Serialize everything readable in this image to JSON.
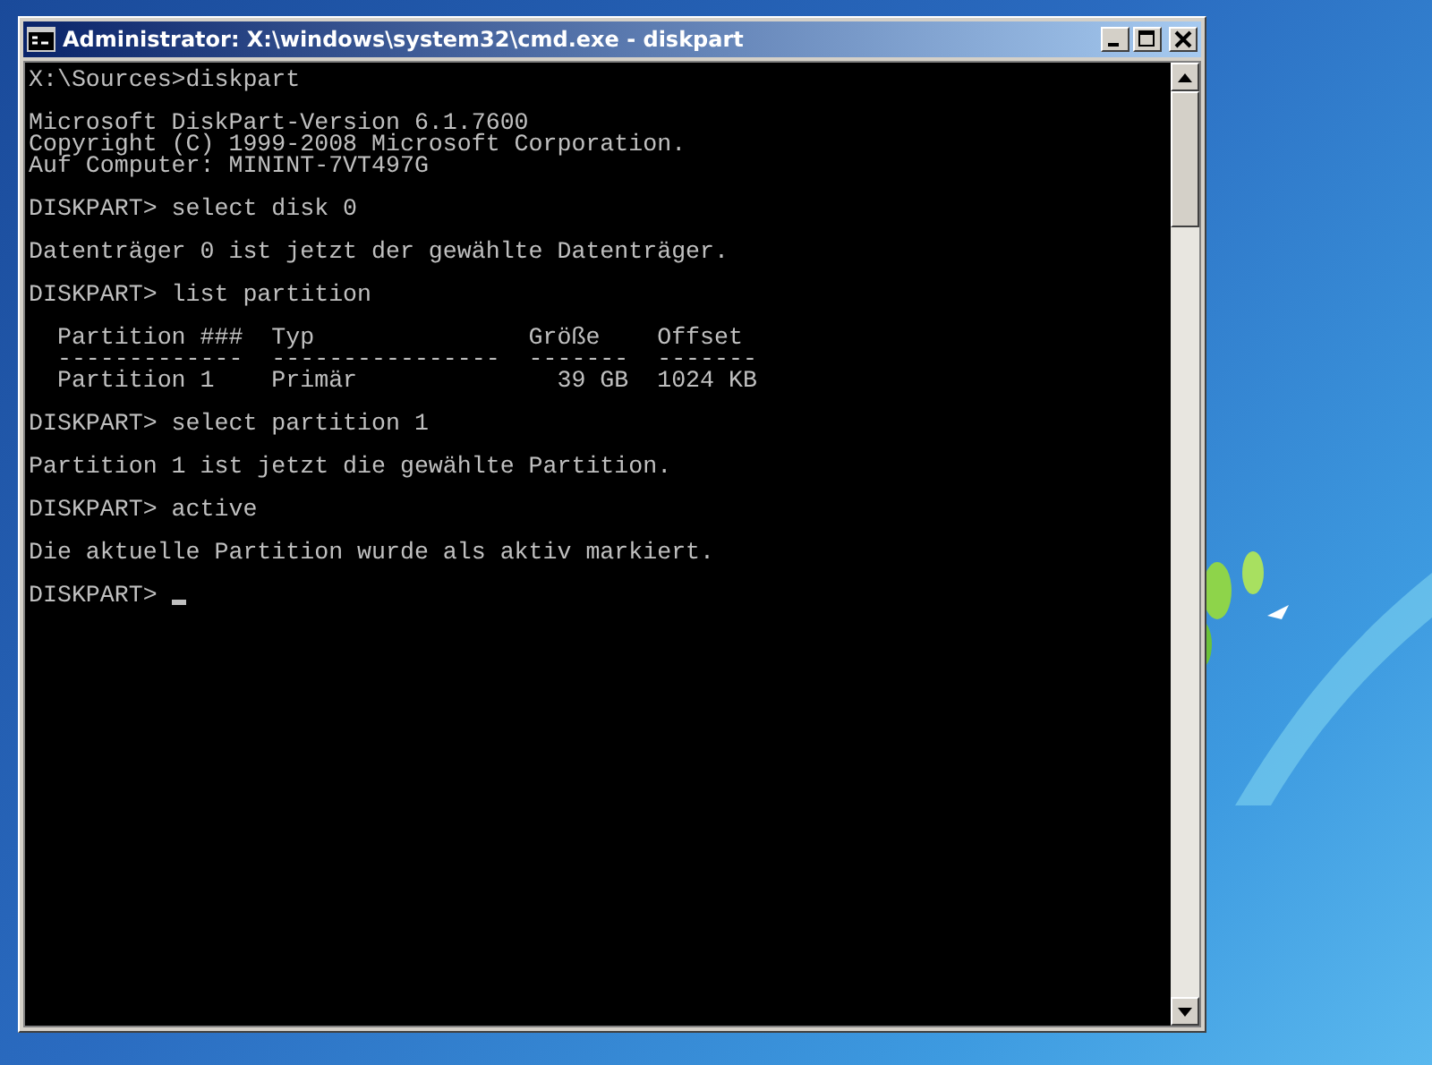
{
  "window": {
    "title": "Administrator: X:\\windows\\system32\\cmd.exe - diskpart"
  },
  "console": {
    "blocks": [
      [
        "X:\\Sources>diskpart"
      ],
      [
        "Microsoft DiskPart-Version 6.1.7600",
        "Copyright (C) 1999-2008 Microsoft Corporation.",
        "Auf Computer: MININT-7VT497G"
      ],
      [
        "DISKPART> select disk 0"
      ],
      [
        "Datenträger 0 ist jetzt der gewählte Datenträger."
      ],
      [
        "DISKPART> list partition"
      ],
      [
        "  Partition ###  Typ               Größe    Offset",
        "  -------------  ----------------  -------  -------",
        "  Partition 1    Primär              39 GB  1024 KB"
      ],
      [
        "DISKPART> select partition 1"
      ],
      [
        "Partition 1 ist jetzt die gewählte Partition."
      ],
      [
        "DISKPART> active"
      ],
      [
        "Die aktuelle Partition wurde als aktiv markiert."
      ]
    ],
    "prompt": "DISKPART>"
  }
}
